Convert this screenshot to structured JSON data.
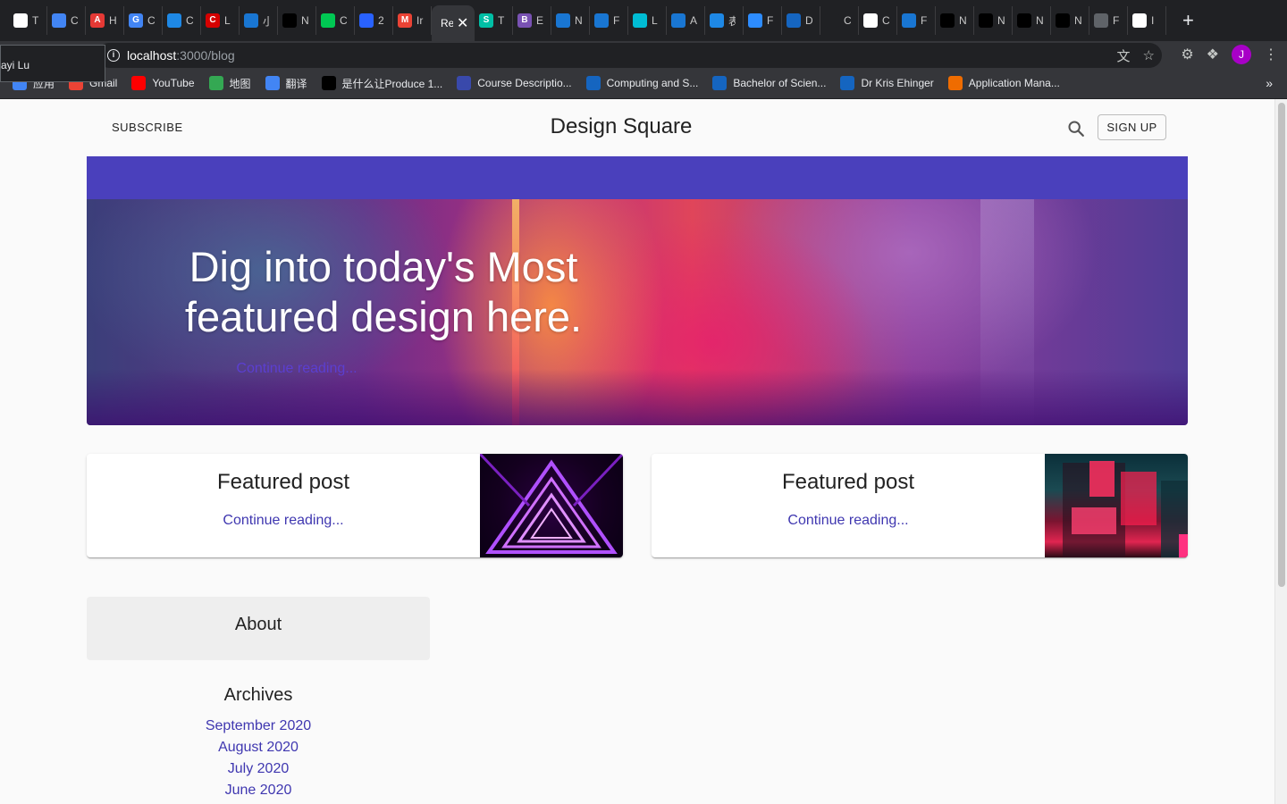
{
  "browser": {
    "tabs": [
      {
        "fav": "doc",
        "label": "T",
        "color": "#ffffff"
      },
      {
        "fav": "gear",
        "label": "C",
        "color": "#4285f4"
      },
      {
        "fav": "A",
        "label": "H",
        "color": "#e53935"
      },
      {
        "fav": "G",
        "label": "C",
        "color": "#4285f4"
      },
      {
        "fav": "arrow",
        "label": "C",
        "color": "#1e88e5"
      },
      {
        "fav": "C",
        "label": "L",
        "color": "#d50000"
      },
      {
        "fav": "mui",
        "label": "小",
        "color": "#1976d2"
      },
      {
        "fav": "medium",
        "label": "N",
        "color": "#000000"
      },
      {
        "fav": "leaf",
        "label": "C",
        "color": "#00c853"
      },
      {
        "fav": "conf",
        "label": "2",
        "color": "#2962ff"
      },
      {
        "fav": "M",
        "label": "Ir",
        "color": "#ea4335"
      },
      {
        "fav": "active",
        "label": "Re",
        "color": "#35363a"
      },
      {
        "fav": "S",
        "label": "T",
        "color": "#00bfa5"
      },
      {
        "fav": "B",
        "label": "E",
        "color": "#7952b3"
      },
      {
        "fav": "mui",
        "label": "N",
        "color": "#1976d2"
      },
      {
        "fav": "mui",
        "label": "F",
        "color": "#1976d2"
      },
      {
        "fav": "react",
        "label": "L",
        "color": "#00bcd4"
      },
      {
        "fav": "mui",
        "label": "A",
        "color": "#1976d2"
      },
      {
        "fav": "chart",
        "label": "表",
        "color": "#1e88e5"
      },
      {
        "fav": "zoom",
        "label": "F",
        "color": "#2d8cff"
      },
      {
        "fav": "unsw",
        "label": "D",
        "color": "#1565c0"
      },
      {
        "fav": "gh",
        "label": "C",
        "color": "#202124"
      },
      {
        "fav": "google",
        "label": "C",
        "color": "#ffffff"
      },
      {
        "fav": "mui",
        "label": "F",
        "color": "#1976d2"
      },
      {
        "fav": "medium",
        "label": "N",
        "color": "#000000"
      },
      {
        "fav": "medium",
        "label": "N",
        "color": "#000000"
      },
      {
        "fav": "medium",
        "label": "N",
        "color": "#000000"
      },
      {
        "fav": "medium",
        "label": "N",
        "color": "#000000"
      },
      {
        "fav": "globe",
        "label": "F",
        "color": "#5f6368"
      },
      {
        "fav": "github",
        "label": "I",
        "color": "#ffffff"
      }
    ],
    "active_tab_label": "Re",
    "url_host": "localhost",
    "url_path": ":3000/blog",
    "tooltip": "ayi Lu",
    "profile_initial": "J",
    "bookmarks": [
      {
        "label": "应用",
        "color": "#4285f4"
      },
      {
        "label": "Gmail",
        "color": "#ea4335"
      },
      {
        "label": "YouTube",
        "color": "#ff0000"
      },
      {
        "label": "地图",
        "color": "#34a853"
      },
      {
        "label": "翻译",
        "color": "#4285f4"
      },
      {
        "label": "是什么让Produce 1...",
        "color": "#000000"
      },
      {
        "label": "Course Descriptio...",
        "color": "#3949ab"
      },
      {
        "label": "Computing and S...",
        "color": "#1565c0"
      },
      {
        "label": "Bachelor of Scien...",
        "color": "#1565c0"
      },
      {
        "label": "Dr Kris Ehinger",
        "color": "#1565c0"
      },
      {
        "label": "Application Mana...",
        "color": "#ef6c00"
      }
    ],
    "bookmarks_more": "»"
  },
  "header": {
    "subscribe_label": "SUBSCRIBE",
    "title": "Design Square",
    "signup_label": "SIGN UP"
  },
  "hero": {
    "title_line1": "Dig into today's Most",
    "title_line2": "featured design here.",
    "link": "Continue reading..."
  },
  "featured": [
    {
      "title": "Featured post",
      "link": "Continue reading..."
    },
    {
      "title": "Featured post",
      "link": "Continue reading..."
    }
  ],
  "sidebar": {
    "about_title": "About",
    "archives_title": "Archives",
    "archives": [
      "September 2020",
      "August 2020",
      "July 2020",
      "June 2020"
    ]
  },
  "colors": {
    "accent": "#4a40bc",
    "link": "#3f37b0"
  }
}
